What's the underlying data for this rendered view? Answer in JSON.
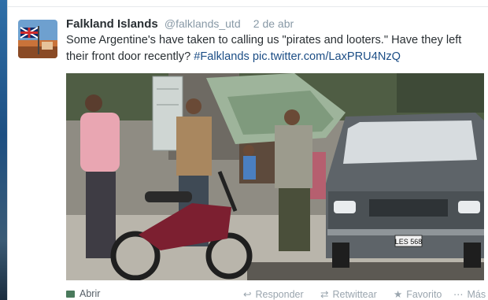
{
  "tweet": {
    "display_name": "Falkland Islands",
    "handle": "@falklands_utd",
    "timestamp": "2 de abr",
    "text_main": "Some Argentine's have taken to calling us \"pirates and looters.\" Have they left their front door recently? ",
    "hashtag": "#Falklands",
    "pic_link": "pic.twitter.com/LaxPRU4NzQ"
  },
  "photo": {
    "license_plate": "LES 568"
  },
  "footer": {
    "open_label": "Abrir",
    "reply_label": "Responder",
    "retweet_label": "Retwittear",
    "favorite_label": "Favorito",
    "more_label": "Más"
  },
  "icons": {
    "reply": "reply-icon",
    "retweet": "retweet-icon",
    "favorite": "star-icon",
    "more": "more-dots-icon",
    "open": "photo-icon"
  }
}
